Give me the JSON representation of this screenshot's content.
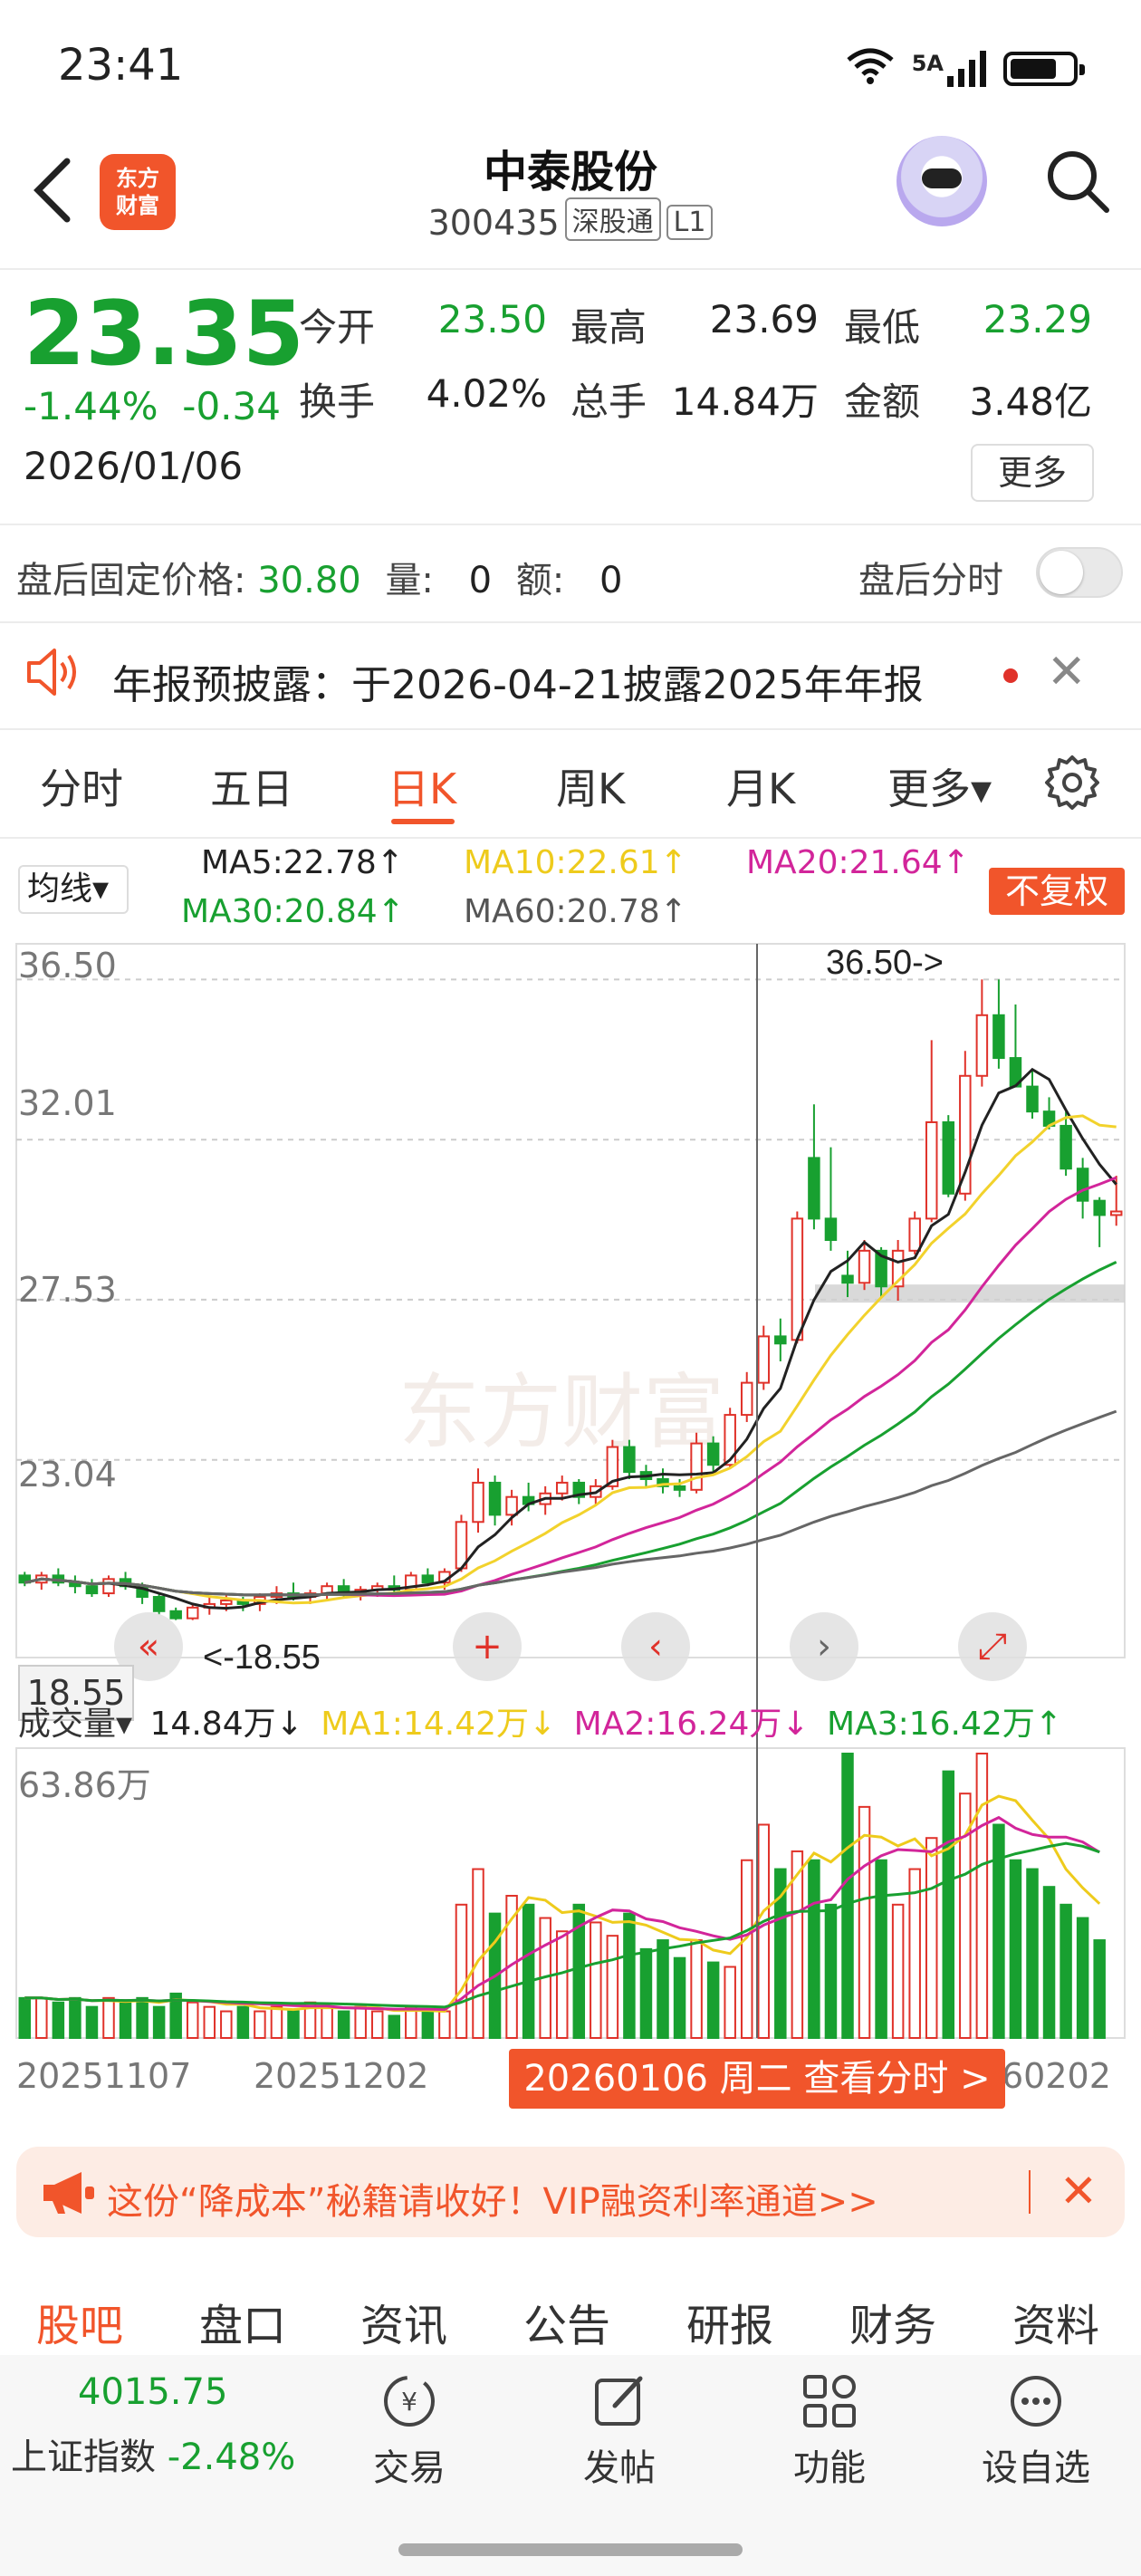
{
  "status_bar": {
    "time": "23:41",
    "network": "5A"
  },
  "header": {
    "logo_text": "东方\n财富",
    "stock_name": "中泰股份",
    "stock_code": "300435",
    "tag_exchange": "深股通",
    "tag_level": "L1"
  },
  "quote": {
    "price": "23.35",
    "change_pct": "-1.44%",
    "change_abs": "-0.34",
    "date": "2026/01/06",
    "fields": [
      {
        "label": "今开",
        "value": "23.50",
        "color": "#18a030"
      },
      {
        "label": "最高",
        "value": "23.69",
        "color": "#222222"
      },
      {
        "label": "最低",
        "value": "23.29",
        "color": "#18a030"
      },
      {
        "label": "换手",
        "value": "4.02%",
        "color": "#222222"
      },
      {
        "label": "总手",
        "value": "14.84万",
        "color": "#222222"
      },
      {
        "label": "金额",
        "value": "3.48亿",
        "color": "#222222"
      }
    ],
    "more_label": "更多"
  },
  "after_hours": {
    "price_label": "盘后固定价格:",
    "price": "30.80",
    "vol_label": "量:",
    "vol": "0",
    "amt_label": "额:",
    "amt": "0",
    "toggle_label": "盘后分时",
    "toggle_on": false
  },
  "notice": {
    "text": "年报预披露：于2026-04-21披露2025年年报"
  },
  "tabs": [
    "分时",
    "五日",
    "日K",
    "周K",
    "月K",
    "更多▾"
  ],
  "ma_legend": {
    "select_label": "均线▾",
    "ma5": "MA5:22.78↑",
    "ma10": "MA10:22.61↑",
    "ma20": "MA20:21.64↑",
    "ma30": "MA30:20.84↑",
    "ma60": "MA60:20.78↑",
    "fq_label": "不复权",
    "colors": {
      "ma5": "#222222",
      "ma10": "#f2d22c",
      "ma20": "#d2259a",
      "ma30": "#18a030",
      "ma60": "#666666"
    }
  },
  "chart_data": {
    "type": "candlestick",
    "y_ticks": [
      "36.50",
      "32.01",
      "27.53",
      "23.04"
    ],
    "ylim": [
      17.5,
      37.5
    ],
    "high_marker": "36.50->",
    "low_marker": "<-18.55",
    "low_tag": "18.55",
    "x_ticks": [
      "20251107",
      "20251202",
      "60202"
    ],
    "candles": [
      [
        19.8,
        19.9,
        19.5,
        19.6
      ],
      [
        19.6,
        19.9,
        19.4,
        19.8
      ],
      [
        19.8,
        20.0,
        19.5,
        19.6
      ],
      [
        19.6,
        19.8,
        19.3,
        19.5
      ],
      [
        19.5,
        19.7,
        19.2,
        19.3
      ],
      [
        19.3,
        19.8,
        19.2,
        19.7
      ],
      [
        19.7,
        19.9,
        19.4,
        19.5
      ],
      [
        19.5,
        19.6,
        19.0,
        19.2
      ],
      [
        19.2,
        19.3,
        18.7,
        18.8
      ],
      [
        18.8,
        18.9,
        18.55,
        18.6
      ],
      [
        18.6,
        19.0,
        18.55,
        18.9
      ],
      [
        18.9,
        19.2,
        18.7,
        19.0
      ],
      [
        19.0,
        19.3,
        18.8,
        19.1
      ],
      [
        19.1,
        19.2,
        18.8,
        19.0
      ],
      [
        19.0,
        19.3,
        18.8,
        19.2
      ],
      [
        19.2,
        19.5,
        19.0,
        19.3
      ],
      [
        19.3,
        19.6,
        19.1,
        19.2
      ],
      [
        19.2,
        19.4,
        19.0,
        19.3
      ],
      [
        19.3,
        19.6,
        19.1,
        19.5
      ],
      [
        19.5,
        19.7,
        19.2,
        19.3
      ],
      [
        19.3,
        19.5,
        19.1,
        19.4
      ],
      [
        19.4,
        19.6,
        19.2,
        19.5
      ],
      [
        19.5,
        19.8,
        19.3,
        19.4
      ],
      [
        19.4,
        19.9,
        19.3,
        19.8
      ],
      [
        19.8,
        20.0,
        19.5,
        19.6
      ],
      [
        19.6,
        20.0,
        19.4,
        19.9
      ],
      [
        20.0,
        21.5,
        19.9,
        21.3
      ],
      [
        21.3,
        22.8,
        21.0,
        22.4
      ],
      [
        22.4,
        22.6,
        21.2,
        21.5
      ],
      [
        21.5,
        22.2,
        21.2,
        22.0
      ],
      [
        22.0,
        22.4,
        21.6,
        21.8
      ],
      [
        21.8,
        22.3,
        21.5,
        22.1
      ],
      [
        22.1,
        22.6,
        21.9,
        22.4
      ],
      [
        22.4,
        22.5,
        21.8,
        22.0
      ],
      [
        22.0,
        22.5,
        21.8,
        22.3
      ],
      [
        22.3,
        23.6,
        22.2,
        23.4
      ],
      [
        23.4,
        23.6,
        22.5,
        22.7
      ],
      [
        22.7,
        22.9,
        22.3,
        22.5
      ],
      [
        22.5,
        22.8,
        22.1,
        22.3
      ],
      [
        22.3,
        22.5,
        22.0,
        22.2
      ],
      [
        22.2,
        23.8,
        22.1,
        23.5
      ],
      [
        23.5,
        23.7,
        22.6,
        22.9
      ],
      [
        22.9,
        24.5,
        22.8,
        24.3
      ],
      [
        24.3,
        25.5,
        24.1,
        25.2
      ],
      [
        25.2,
        26.8,
        25.0,
        26.5
      ],
      [
        26.5,
        27.0,
        25.8,
        26.3
      ],
      [
        26.4,
        30.0,
        26.3,
        29.8
      ],
      [
        31.5,
        33.0,
        29.5,
        29.8
      ],
      [
        29.8,
        31.8,
        28.9,
        29.2
      ],
      [
        28.2,
        28.9,
        27.6,
        28.0
      ],
      [
        28.0,
        29.2,
        27.8,
        28.9
      ],
      [
        28.9,
        29.0,
        27.6,
        27.9
      ],
      [
        27.9,
        29.2,
        27.5,
        28.9
      ],
      [
        28.9,
        30.0,
        28.8,
        29.8
      ],
      [
        29.8,
        34.8,
        29.7,
        32.5
      ],
      [
        32.5,
        32.7,
        30.4,
        30.5
      ],
      [
        30.5,
        34.5,
        30.3,
        33.8
      ],
      [
        33.8,
        36.5,
        33.5,
        35.5
      ],
      [
        35.5,
        36.5,
        34.0,
        34.3
      ],
      [
        34.3,
        35.8,
        33.5,
        33.5
      ],
      [
        33.5,
        34.0,
        32.6,
        32.8
      ],
      [
        32.8,
        33.2,
        32.3,
        32.4
      ],
      [
        32.4,
        32.8,
        31.0,
        31.2
      ],
      [
        31.2,
        31.5,
        29.8,
        30.3
      ],
      [
        30.3,
        30.4,
        29.0,
        29.9
      ],
      [
        29.9,
        31.0,
        29.6,
        30.0
      ]
    ],
    "volume_ylabel": "63.86万",
    "volume_legend": {
      "label": "成交量▾",
      "vol": "14.84万↓",
      "ma1": "MA1:14.42万↓",
      "ma2": "MA2:16.24万↓",
      "ma3": "MA3:16.42万↑"
    },
    "volumes": [
      9,
      9,
      8,
      9,
      7,
      9,
      8,
      9,
      7,
      10,
      8,
      7,
      6,
      7,
      6,
      7,
      6,
      8,
      7,
      6,
      7,
      6,
      5,
      7,
      6,
      6,
      30,
      38,
      28,
      32,
      30,
      27,
      24,
      30,
      26,
      23,
      28,
      20,
      22,
      18,
      22,
      17,
      16,
      40,
      48,
      38,
      42,
      40,
      30,
      64,
      52,
      40,
      30,
      38,
      45,
      60,
      55,
      64,
      48,
      40,
      38,
      34,
      30,
      27,
      22
    ],
    "date_tip": "20260106 周二 查看分时 >"
  },
  "promo": {
    "text": "这份“降成本”秘籍请收好！VIP融资利率通道>>"
  },
  "bottom_tabs": [
    "股吧",
    "盘口",
    "资讯",
    "公告",
    "研报",
    "财务",
    "资料"
  ],
  "bottom_nav": {
    "index_value": "4015.75",
    "index_name": "上证指数",
    "index_change": "-2.48%",
    "items": [
      "交易",
      "发帖",
      "功能",
      "设自选"
    ]
  },
  "watermark": "东方财富",
  "colors": {
    "accent": "#f1552b",
    "up": "#e0322a",
    "down": "#18a030"
  }
}
